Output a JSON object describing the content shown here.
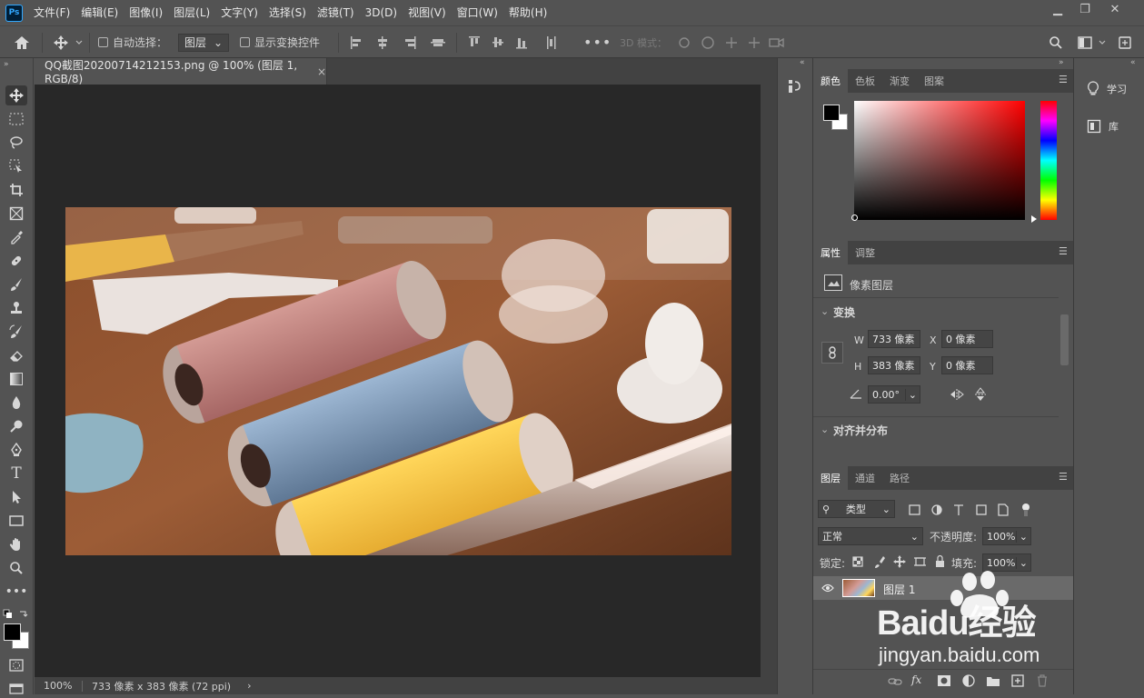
{
  "menubar": {
    "logo": "Ps",
    "items": [
      "文件(F)",
      "编辑(E)",
      "图像(I)",
      "图层(L)",
      "文字(Y)",
      "选择(S)",
      "滤镜(T)",
      "3D(D)",
      "视图(V)",
      "窗口(W)",
      "帮助(H)"
    ],
    "window_controls": {
      "minimize": "▁",
      "restore": "❐",
      "close": "✕"
    }
  },
  "options": {
    "auto_select_label": "自动选择：",
    "auto_select_value": "图层",
    "show_transform_label": "显示变换控件",
    "mode_3d_label": "3D 模式："
  },
  "document": {
    "tab_title": "QQ截图20200714212153.png @ 100% (图层 1, RGB/8)",
    "tab_close": "×"
  },
  "statusbar": {
    "zoom": "100%",
    "dimensions": "733 像素 x 383 像素 (72 ppi)",
    "arrow": "›"
  },
  "color_panel": {
    "tabs": [
      "颜色",
      "色板",
      "渐变",
      "图案"
    ],
    "active_tab": "颜色",
    "foreground": "#000000",
    "background": "#ffffff",
    "hue_color": "#ff0000"
  },
  "properties_panel": {
    "tabs": [
      "属性",
      "调整"
    ],
    "layer_type": "像素图层",
    "transform_title": "变换",
    "w_label": "W",
    "w_value": "733 像素",
    "h_label": "H",
    "h_value": "383 像素",
    "x_label": "X",
    "x_value": "0 像素",
    "y_label": "Y",
    "y_value": "0 像素",
    "angle_value": "0.00°",
    "align_title": "对齐并分布"
  },
  "layers_panel": {
    "tabs": [
      "图层",
      "通道",
      "路径"
    ],
    "filter_kind": "类型",
    "blend_mode": "正常",
    "opacity_label": "不透明度:",
    "opacity_value": "100%",
    "lock_label": "锁定:",
    "fill_label": "填充:",
    "fill_value": "100%",
    "layers": [
      {
        "name": "图层 1",
        "visible": true
      }
    ]
  },
  "right_strip": {
    "learn_label": "学习",
    "library_label": "库"
  },
  "watermark": {
    "brand": "Baidu经验",
    "url": "jingyan.baidu.com"
  },
  "colors": {
    "accent": "#31a8ff",
    "ui_bg": "#535353",
    "canvas_bg": "#282828",
    "tab_bg": "#424242"
  }
}
